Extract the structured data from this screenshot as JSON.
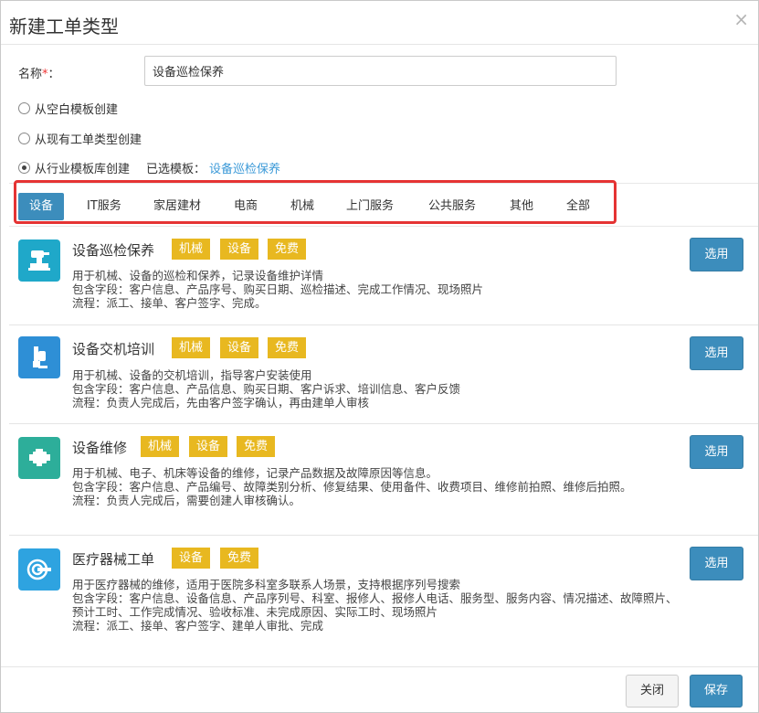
{
  "dialog": {
    "title": "新建工单类型",
    "close_glyph": "×"
  },
  "name_field": {
    "label": "名称",
    "required_mark": "*",
    "colon": "：",
    "value": "设备巡检保养"
  },
  "create_options": [
    {
      "label": "从空白模板创建",
      "checked": false
    },
    {
      "label": "从现有工单类型创建",
      "checked": false
    },
    {
      "label": "从行业模板库创建",
      "checked": true
    }
  ],
  "selected_template": {
    "label": "已选模板：",
    "value": "设备巡检保养"
  },
  "tabs": [
    {
      "label": "设备",
      "active": true
    },
    {
      "label": "IT服务",
      "active": false
    },
    {
      "label": "家居建材",
      "active": false
    },
    {
      "label": "电商",
      "active": false
    },
    {
      "label": "机械",
      "active": false
    },
    {
      "label": "上门服务",
      "active": false
    },
    {
      "label": "公共服务",
      "active": false
    },
    {
      "label": "其他",
      "active": false
    },
    {
      "label": "全部",
      "active": false
    }
  ],
  "templates": [
    {
      "title": "设备巡检保养",
      "icon": "sander-icon",
      "icon_color": "#1fa8c9",
      "tags": [
        "机械",
        "设备",
        "免费"
      ],
      "desc": [
        "用于机械、设备的巡检和保养，记录设备维护详情",
        "包含字段：客户信息、产品序号、购买日期、巡检描述、完成工作情况、现场照片",
        "流程：派工、接单、客户签字、完成。"
      ],
      "button": "选用"
    },
    {
      "title": "设备交机培训",
      "icon": "drill-icon",
      "icon_color": "#2e8fd6",
      "tags": [
        "机械",
        "设备",
        "免费"
      ],
      "desc": [
        "用于机械、设备的交机培训，指导客户安装使用",
        "包含字段：客户信息、产品信息、购买日期、客户诉求、培训信息、客户反馈",
        "流程：负责人完成后，先由客户签字确认，再由建单人审核"
      ],
      "button": "选用"
    },
    {
      "title": "设备维修",
      "icon": "engine-icon",
      "icon_color": "#2dae9a",
      "tags": [
        "机械",
        "设备",
        "免费"
      ],
      "desc": [
        "用于机械、电子、机床等设备的维修，记录产品数据及故障原因等信息。",
        "包含字段：客户信息、产品编号、故障类别分析、修复结果、使用备件、收费项目、维修前拍照、维修后拍照。",
        "流程：负责人完成后，需要创建人审核确认。"
      ],
      "button": "选用"
    },
    {
      "title": "医疗器械工单",
      "icon": "medical-scanner-icon",
      "icon_color": "#2ea3e0",
      "tags": [
        "设备",
        "免费"
      ],
      "desc": [
        "用于医疗器械的维修，适用于医院多科室多联系人场景，支持根据序列号搜索",
        "包含字段：客户信息、设备信息、产品序列号、科室、报修人、报修人电话、服务型、服务内容、情况描述、故障照片、预计工时、工作完成情况、验收标准、未完成原因、实际工时、现场照片",
        "流程：派工、接单、客户签字、建单人审批、完成"
      ],
      "button": "选用"
    }
  ],
  "footer": {
    "close_label": "关闭",
    "save_label": "保存"
  }
}
